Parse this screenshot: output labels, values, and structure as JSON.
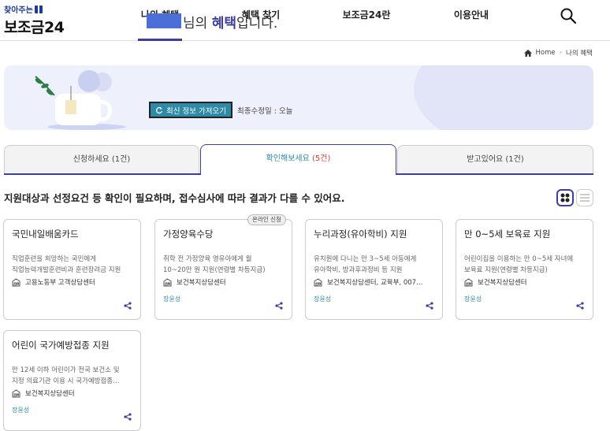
{
  "header": {
    "logo_top": "찾아주는",
    "logo_main": "보조금24",
    "nav": [
      "나의 혜택",
      "혜택 찾기",
      "보조금24란",
      "이용안내"
    ]
  },
  "breadcrumb": {
    "home": "Home",
    "current": "나의 혜택"
  },
  "banner": {
    "title_mid": "님의 ",
    "title_bold": "혜택",
    "title_end": "입니다.",
    "refresh_label": "최신 정보 가져오기",
    "update_text": "최종수정일 : 오늘"
  },
  "tabs": [
    {
      "label": "신청하세요 ",
      "count": "(1건)"
    },
    {
      "label": "확인해보세요 ",
      "count": "(5건)"
    },
    {
      "label": "받고있어요 ",
      "count": "(1건)"
    }
  ],
  "notice": "지원대상과 선정요건 등 확인이 필요하며, 접수심사에 따라 결과가 다를 수 있어요.",
  "cards": [
    {
      "title": "국민내일배움카드",
      "desc1": "직업훈련을 희망하는 국민에게",
      "desc2": "직업능력개발훈련비과 훈련장려금 지원",
      "org": "고용노동부 고객상담센터",
      "tag": ""
    },
    {
      "title": "가정양육수당",
      "badge": "온라인 신청",
      "desc1": "취학 전 가정양육 영유아에게 월",
      "desc2": "10~20만 원 지원(연령별 차등지급)",
      "org": "보건복지상담센터",
      "tag": "장윤성"
    },
    {
      "title": "누리과정(유아학비) 지원",
      "desc1": "유치원에 다니는 만 3~5세 아동에게",
      "desc2": "유아학비, 방과후과정비 등 지원",
      "org": "보건복지상담센터, 교육부, 007…",
      "tag": "장윤성"
    },
    {
      "title": "만 0~5세 보육료 지원",
      "desc1": "어린이집을 이용하는 만 0~5세 자녀에",
      "desc2": "보육료 지원(연령별 차등지급)",
      "org": "보건복지상담센터",
      "tag": "장윤성"
    },
    {
      "title": "어린이 국가예방접종 지원",
      "desc1": "만 12세 이하 어린이가 전국 보건소 및",
      "desc2": "지정 의료기관 이용 시 국가예방접종…",
      "org": "보건복지상담센터",
      "tag": "장윤성"
    }
  ],
  "colors": {
    "accent": "#3c3f9e",
    "teal": "#2e8aa6",
    "red": "#e03c31"
  }
}
